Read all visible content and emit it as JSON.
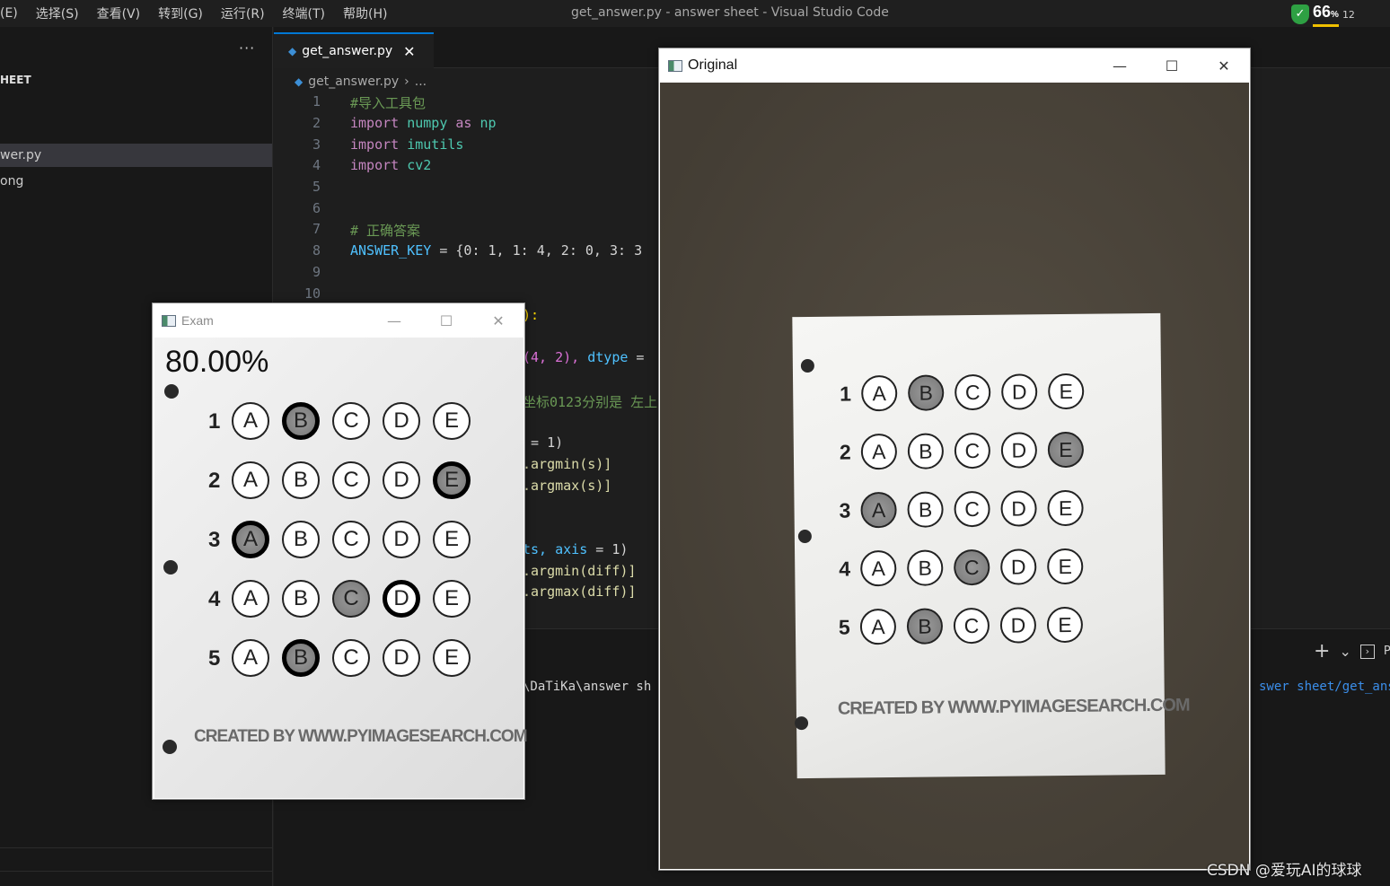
{
  "titlebar": {
    "menu": [
      "(E)",
      "选择(S)",
      "查看(V)",
      "转到(G)",
      "运行(R)",
      "终端(T)",
      "帮助(H)"
    ],
    "window_title": "get_answer.py - answer sheet - Visual Studio Code",
    "tray": {
      "battery_percent": "66",
      "percent_sign": "%",
      "extra": "12"
    }
  },
  "sidebar": {
    "more": "···",
    "title": "HEET",
    "files": [
      "wer.py",
      "ong"
    ]
  },
  "tab": {
    "label": "get_answer.py",
    "close": "✕"
  },
  "breadcrumb": {
    "file": "get_answer.py",
    "sep": "›",
    "more": "..."
  },
  "code": {
    "line_numbers": [
      "1",
      "2",
      "3",
      "4",
      "5",
      "6",
      "7",
      "8",
      "9",
      "10"
    ],
    "l1": "#导入工具包",
    "l2_kw": "import",
    "l2_mod": "numpy",
    "l2_as": "as",
    "l2_alias": "np",
    "l3_kw": "import",
    "l3_mod": "imutils",
    "l4_kw": "import",
    "l4_mod": "cv2",
    "l7": "# 正确答案",
    "l8_var": "ANSWER_KEY",
    "l8_rest": " = {0: 1, 1: 4, 2: 0, 3: 3",
    "f11": "):",
    "f12a": "(4, 2), ",
    "f12b": "dtype",
    "f12c": " =",
    "f13": "坐标0123分别是 左上",
    "f15": " = 1)",
    "f16": ".argmin(s)]",
    "f17": ".argmax(s)]",
    "f19a": "ts, ",
    "f19b": "axis",
    "f19c": " = 1)",
    "f20": ".argmin(diff)]",
    "f21": ".argmax(diff)]"
  },
  "terminal": {
    "path_left": "\\DaTiKa\\answer sh",
    "path_right": "swer sheet/get_ans",
    "plus": "+",
    "chevron": "⌄",
    "shell_label": "Py"
  },
  "exam_window": {
    "title": "Exam",
    "score": "80.00%",
    "credit": "CREATED BY WWW.PYIMAGESEARCH.COM"
  },
  "original_window": {
    "title": "Original",
    "credit": "CREATED BY WWW.PYIMAGESEARCH.COM"
  },
  "window_buttons": {
    "minimize": "—",
    "maximize": "☐",
    "close": "✕"
  },
  "sheet": {
    "options": [
      "A",
      "B",
      "C",
      "D",
      "E"
    ],
    "questions": [
      {
        "num": "1",
        "filled": 1,
        "correct_ring": 1
      },
      {
        "num": "2",
        "filled": 4,
        "correct_ring": 4
      },
      {
        "num": "3",
        "filled": 0,
        "correct_ring": 0
      },
      {
        "num": "4",
        "filled": 2,
        "correct_ring": 3
      },
      {
        "num": "5",
        "filled": 1,
        "correct_ring": 1
      }
    ]
  },
  "watermark": "CSDN @爱玩AI的球球",
  "colors": {
    "accent": "#0078d4",
    "keyword": "#c586c0",
    "module": "#4ec9b0",
    "comment": "#6a9955",
    "variable": "#4fc1ff",
    "desk": "#4a443a"
  }
}
